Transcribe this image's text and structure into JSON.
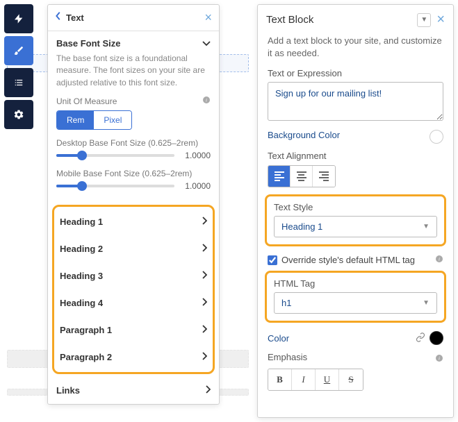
{
  "left": {
    "title": "Text",
    "baseFontSize": {
      "label": "Base Font Size",
      "description": "The base font size is a foundational measure. The font sizes on your site are adjusted relative to this font size.",
      "unitLabel": "Unit Of Measure",
      "unitOptions": {
        "rem": "Rem",
        "pixel": "Pixel"
      }
    },
    "desktopSlider": {
      "label": "Desktop Base Font Size (0.625–2rem)",
      "value": "1.0000"
    },
    "mobileSlider": {
      "label": "Mobile Base Font Size (0.625–2rem)",
      "value": "1.0000"
    },
    "styles": [
      "Heading 1",
      "Heading 2",
      "Heading 3",
      "Heading 4",
      "Paragraph 1",
      "Paragraph 2"
    ],
    "linksLabel": "Links"
  },
  "right": {
    "title": "Text Block",
    "description": "Add a text block to your site, and customize it as needed.",
    "textExprLabel": "Text or Expression",
    "textExprValue": "Sign up for our mailing list!",
    "bgColorLabel": "Background Color",
    "alignLabel": "Text Alignment",
    "textStyle": {
      "label": "Text Style",
      "value": "Heading 1"
    },
    "override": {
      "label": "Override style's default HTML tag",
      "checked": true
    },
    "htmlTag": {
      "label": "HTML Tag",
      "value": "h1"
    },
    "colorLabel": "Color",
    "emphasisLabel": "Emphasis",
    "emph": {
      "b": "B",
      "i": "I",
      "u": "U",
      "s": "S"
    }
  }
}
